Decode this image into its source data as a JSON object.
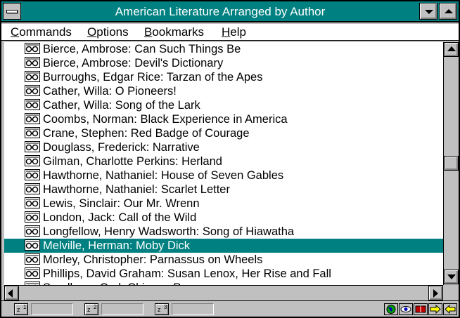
{
  "window": {
    "title": "American Literature Arranged by Author",
    "accent_color": "#008080"
  },
  "menu": {
    "commands": {
      "mnemonic": "C",
      "rest": "ommands"
    },
    "options": {
      "mnemonic": "O",
      "rest": "ptions"
    },
    "bookmarks": {
      "mnemonic": "B",
      "rest": "ookmarks"
    },
    "help": {
      "mnemonic": "H",
      "rest": "elp"
    }
  },
  "list": {
    "icon": "book-icon",
    "items": [
      {
        "label": "Bierce, Ambrose: Can Such Things Be"
      },
      {
        "label": "Bierce, Ambrose: Devil's Dictionary"
      },
      {
        "label": "Burroughs, Edgar Rice: Tarzan of the Apes"
      },
      {
        "label": "Cather, Willa: O Pioneers!"
      },
      {
        "label": "Cather, Willa: Song of the Lark"
      },
      {
        "label": "Coombs, Norman: Black Experience in America"
      },
      {
        "label": "Crane, Stephen: Red Badge of Courage"
      },
      {
        "label": "Douglass, Frederick: Narrative"
      },
      {
        "label": "Gilman, Charlotte Perkins: Herland"
      },
      {
        "label": "Hawthorne, Nathaniel: House of Seven Gables"
      },
      {
        "label": "Hawthorne, Nathaniel: Scarlet Letter"
      },
      {
        "label": "Lewis, Sinclair: Our Mr. Wrenn"
      },
      {
        "label": "London, Jack: Call of the Wild"
      },
      {
        "label": "Longfellow, Henry Wadsworth: Song of Hiawatha"
      },
      {
        "label": "Melville, Herman: Moby Dick",
        "selected": true
      },
      {
        "label": "Morley, Christopher: Parnassus on Wheels"
      },
      {
        "label": "Phillips, David Graham: Susan Lenox, Her Rise and Fall"
      },
      {
        "label": "Sandburg, Carl: Chicago Poems"
      }
    ]
  },
  "statusbar": {
    "zoom_buttons": [
      {
        "z": "z",
        "n": "1"
      },
      {
        "z": "z",
        "n": "2"
      },
      {
        "z": "z",
        "n": "3"
      }
    ],
    "icons": [
      "globe-icon",
      "eye-icon",
      "book-open-icon",
      "right-arrow-icon",
      "left-arrow-icon"
    ]
  }
}
